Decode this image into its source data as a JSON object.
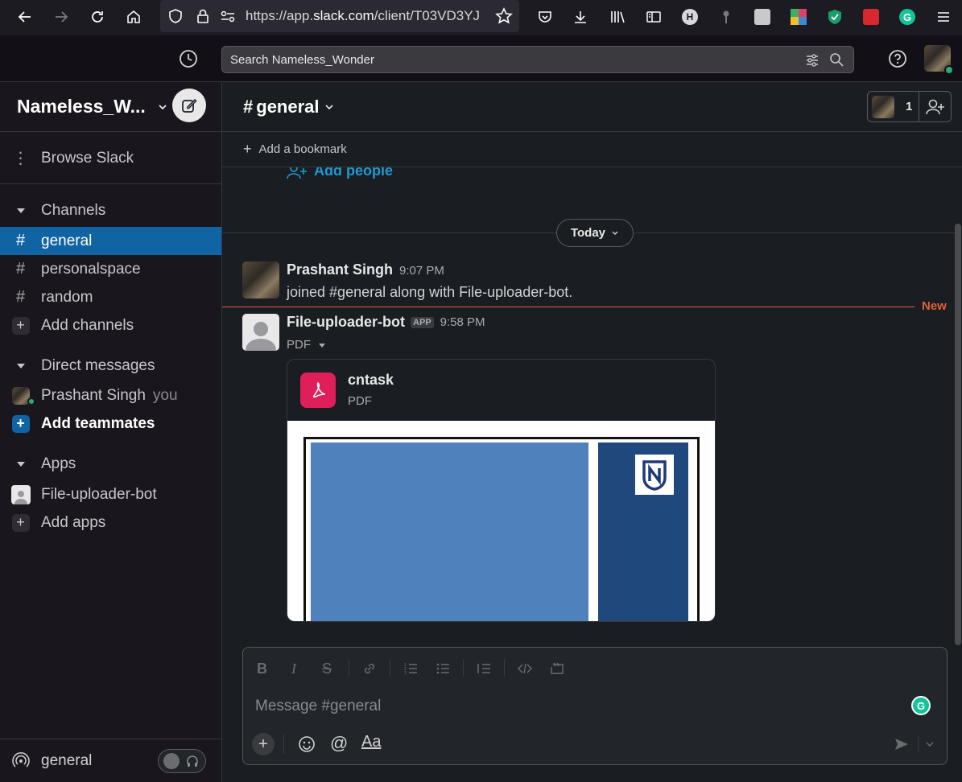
{
  "browser": {
    "url_prefix": "https://app.",
    "url_host": "slack.com",
    "url_path": "/client/T03VD3YJ"
  },
  "topbar": {
    "search_placeholder": "Search Nameless_Wonder"
  },
  "sidebar": {
    "workspace_name": "Nameless_W...",
    "browse_label": "Browse Slack",
    "channels_heading": "Channels",
    "channels": [
      "general",
      "personalspace",
      "random"
    ],
    "add_channels": "Add channels",
    "dm_heading": "Direct messages",
    "dm_user": "Prashant Singh",
    "dm_you": "you",
    "add_teammates": "Add teammates",
    "apps_heading": "Apps",
    "app_name": "File-uploader-bot",
    "add_apps": "Add apps",
    "huddle_channel": "general"
  },
  "channel": {
    "name": "general",
    "member_count": "1",
    "add_bookmark": "Add a bookmark",
    "add_people": "Add people",
    "date_divider": "Today",
    "new_label": "New"
  },
  "messages": [
    {
      "author": "Prashant Singh",
      "time": "9:07 PM",
      "text": "joined #general along with File-uploader-bot."
    },
    {
      "author": "File-uploader-bot",
      "badge": "APP",
      "time": "9:58 PM",
      "file_type_toggle": "PDF",
      "file_name": "cntask",
      "file_type": "PDF"
    }
  ],
  "composer": {
    "placeholder": "Message #general"
  },
  "colors": {
    "accent": "#1164a3",
    "pdf_red": "#e01e5a",
    "new_line": "#e0603c",
    "link_blue": "#1d9bd1"
  }
}
